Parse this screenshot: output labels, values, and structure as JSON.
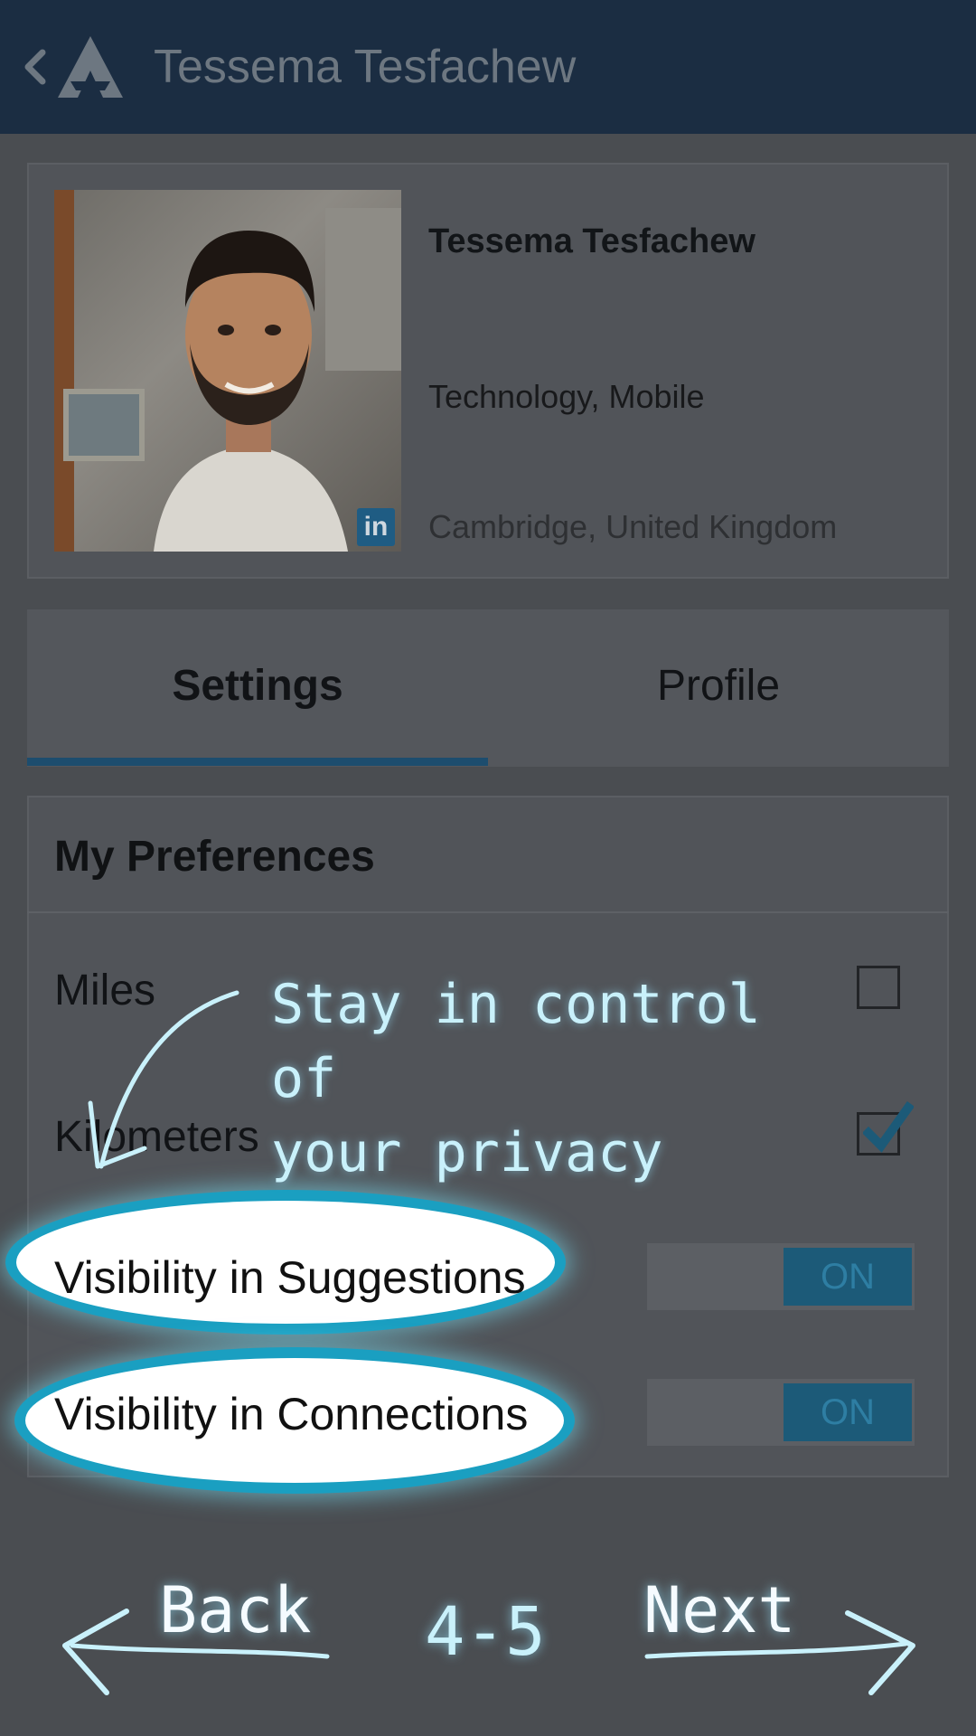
{
  "appbar": {
    "title": "Tessema Tesfachew",
    "back_icon": "chevron-left-icon",
    "logo_icon": "app-logo-icon"
  },
  "profile": {
    "name": "Tessema Tesfachew",
    "industry": "Technology, Mobile",
    "location": "Cambridge, United Kingdom",
    "badge": "in",
    "badge_icon": "linkedin-icon"
  },
  "tabs": [
    {
      "label": "Settings",
      "selected": true
    },
    {
      "label": "Profile",
      "selected": false
    }
  ],
  "preferences": {
    "title": "My Preferences",
    "miles_label": "Miles",
    "miles_checked": false,
    "km_label": "Kilometers",
    "km_checked": true,
    "suggestions_label": "Visibility in Suggestions",
    "suggestions_toggle": "ON",
    "connections_label": "Visibility in Connections",
    "connections_toggle": "ON"
  },
  "overlay": {
    "callout_line1": "Stay in control of",
    "callout_line2": "your privacy",
    "back_label": "Back",
    "next_label": "Next",
    "page_indicator": "4-5"
  },
  "colors": {
    "appbar": "#1b2d42",
    "accent": "#1d4d6e",
    "highlight_ring": "#1a9fc1",
    "callout_text": "#c9f1fb"
  }
}
